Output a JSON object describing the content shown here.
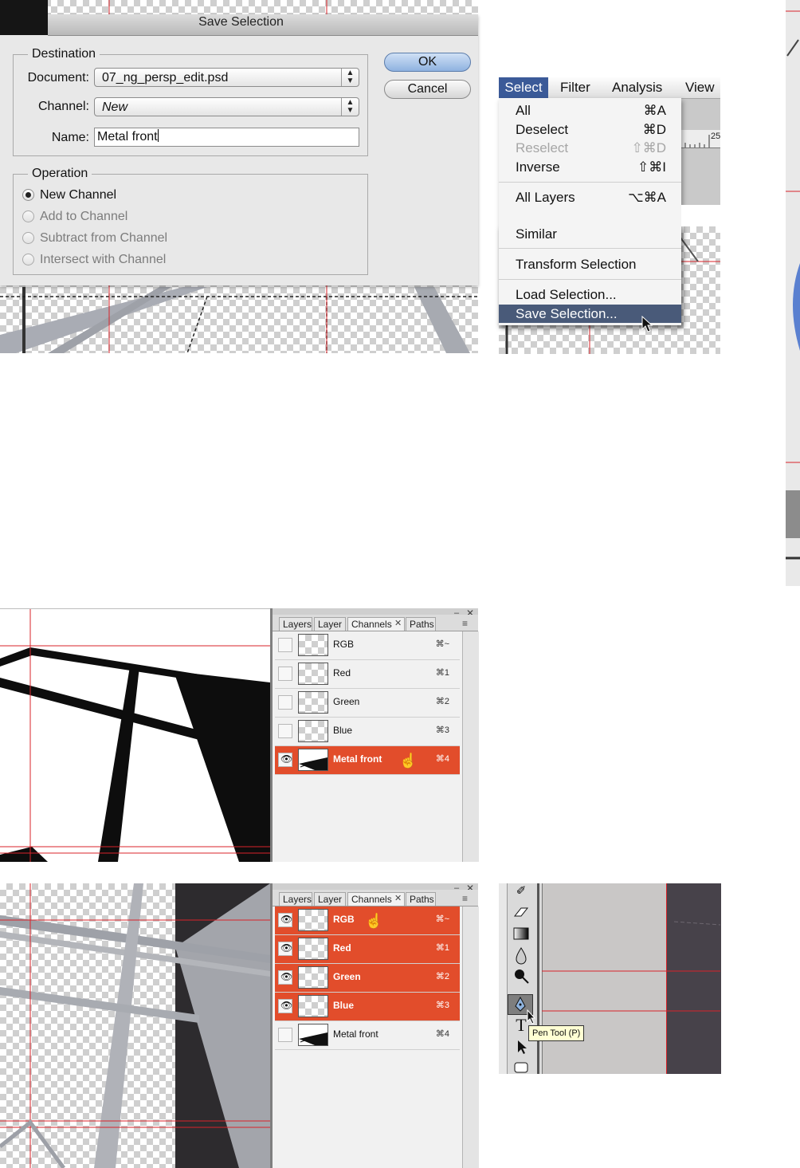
{
  "save_dialog": {
    "title": "Save Selection",
    "destination_legend": "Destination",
    "document_label": "Document:",
    "document_value": "07_ng_persp_edit.psd",
    "channel_label": "Channel:",
    "channel_value": "New",
    "name_label": "Name:",
    "name_value": "Metal front",
    "ok_label": "OK",
    "cancel_label": "Cancel",
    "operation_legend": "Operation",
    "operations": [
      {
        "label": "New Channel",
        "selected": true,
        "enabled": true
      },
      {
        "label": "Add to Channel",
        "selected": false,
        "enabled": false
      },
      {
        "label": "Subtract from Channel",
        "selected": false,
        "enabled": false
      },
      {
        "label": "Intersect with Channel",
        "selected": false,
        "enabled": false
      }
    ]
  },
  "menubar": {
    "items": [
      "Select",
      "Filter",
      "Analysis",
      "View"
    ],
    "active": "Select"
  },
  "select_menu": {
    "items": [
      {
        "label": "All",
        "shortcut": "⌘A"
      },
      {
        "label": "Deselect",
        "shortcut": "⌘D"
      },
      {
        "label": "Reselect",
        "shortcut": "⇧⌘D",
        "disabled": true
      },
      {
        "label": "Inverse",
        "shortcut": "⇧⌘I"
      },
      {
        "label": "All Layers",
        "shortcut": "⌥⌘A"
      },
      {
        "label": "Similar"
      },
      {
        "label": "Transform Selection"
      },
      {
        "label": "Load Selection..."
      },
      {
        "label": "Save Selection...",
        "highlighted": true
      }
    ],
    "ruler_number": "25"
  },
  "channels_panel_1": {
    "tabs": [
      "Layers",
      "Layer C",
      "Channels",
      "Paths"
    ],
    "active_tab": "Channels",
    "rows": [
      {
        "name": "RGB",
        "shortcut": "⌘~",
        "visible": false,
        "selected": false
      },
      {
        "name": "Red",
        "shortcut": "⌘1",
        "visible": false,
        "selected": false
      },
      {
        "name": "Green",
        "shortcut": "⌘2",
        "visible": false,
        "selected": false
      },
      {
        "name": "Blue",
        "shortcut": "⌘3",
        "visible": false,
        "selected": false
      },
      {
        "name": "Metal front",
        "shortcut": "⌘4",
        "visible": true,
        "selected": true
      }
    ]
  },
  "channels_panel_2": {
    "tabs": [
      "Layers",
      "Layer C",
      "Channels",
      "Paths"
    ],
    "active_tab": "Channels",
    "rows": [
      {
        "name": "RGB",
        "shortcut": "⌘~",
        "visible": true,
        "selected": true
      },
      {
        "name": "Red",
        "shortcut": "⌘1",
        "visible": true,
        "selected": true
      },
      {
        "name": "Green",
        "shortcut": "⌘2",
        "visible": true,
        "selected": true
      },
      {
        "name": "Blue",
        "shortcut": "⌘3",
        "visible": true,
        "selected": true
      },
      {
        "name": "Metal front",
        "shortcut": "⌘4",
        "visible": false,
        "selected": false
      }
    ]
  },
  "tools": {
    "tooltip": "Pen Tool (P)",
    "type_tool_glyph": "T"
  },
  "colors": {
    "highlight_orange": "#e24d2b",
    "menu_select_blue": "#3b5a98",
    "menu_highlight": "#495a79",
    "guide_red": "#d9232a"
  }
}
